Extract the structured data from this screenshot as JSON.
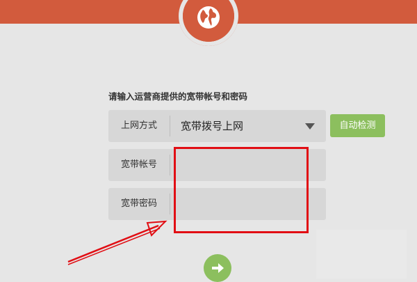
{
  "header": {
    "logo_icon": "globe-icon",
    "brand_color": "#d25b3d"
  },
  "form": {
    "prompt": "请输入运营商提供的宽带帐号和密码",
    "connection_type": {
      "label": "上网方式",
      "selected": "宽带拨号上网",
      "icon": "caret-down-icon"
    },
    "auto_detect_label": "自动检测",
    "account": {
      "label": "宽带帐号",
      "value": ""
    },
    "password": {
      "label": "宽带密码",
      "value": ""
    },
    "next_icon": "arrow-right-icon",
    "accent_color": "#8cbf5e"
  },
  "annotation": {
    "highlight_color": "#e10e14"
  }
}
